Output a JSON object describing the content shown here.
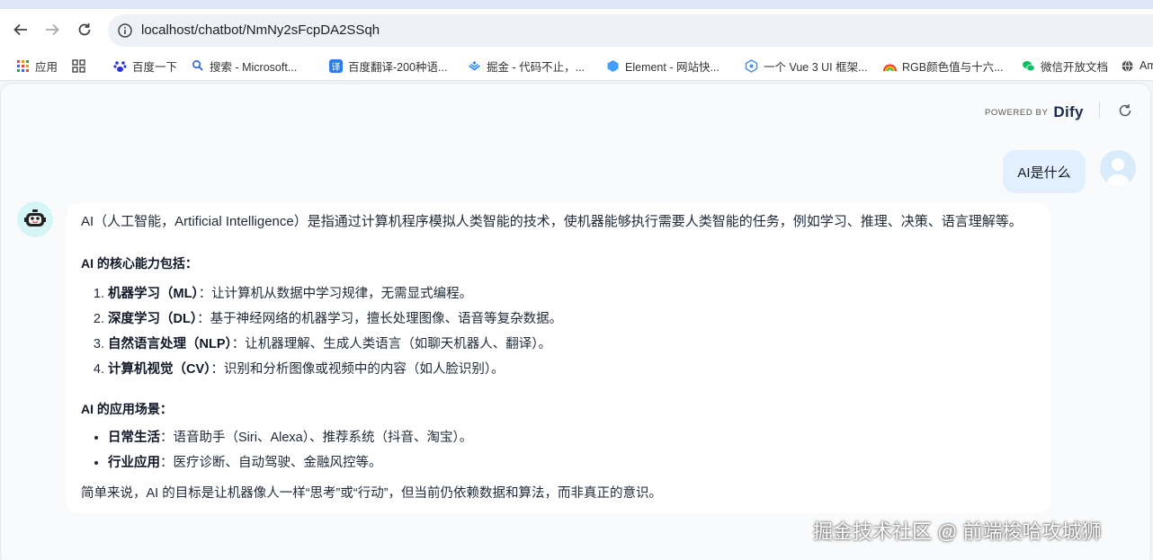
{
  "browser": {
    "url": "localhost/chatbot/NmNy2sFcpDA2SSqh",
    "bookmarks": [
      "应用",
      "百度一下",
      "搜索 - Microsoft...",
      "百度翻译-200种语...",
      "掘金 - 代码不止，...",
      "Element - 网站快...",
      "一个 Vue 3 UI 框架...",
      "RGB颜色值与十六...",
      "微信开放文档",
      "Am"
    ]
  },
  "header": {
    "powered_by": "POWERED BY",
    "brand": "Dify"
  },
  "chat": {
    "user_message": "AI是什么",
    "answer": {
      "intro": "AI（人工智能，Artificial Intelligence）是指通过计算机程序模拟人类智能的技术，使机器能够执行需要人类智能的任务，例如学习、推理、决策、语言理解等。",
      "core_heading": "AI 的核心能力包括：",
      "core_items": [
        {
          "term": "机器学习（ML）",
          "desc": "：让计算机从数据中学习规律，无需显式编程。"
        },
        {
          "term": "深度学习（DL）",
          "desc": "：基于神经网络的机器学习，擅长处理图像、语音等复杂数据。"
        },
        {
          "term": "自然语言处理（NLP）",
          "desc": "：让机器理解、生成人类语言（如聊天机器人、翻译）。"
        },
        {
          "term": "计算机视觉（CV）",
          "desc": "：识别和分析图像或视频中的内容（如人脸识别）。"
        }
      ],
      "scene_heading": "AI 的应用场景：",
      "scene_items": [
        {
          "term": "日常生活",
          "desc": "：语音助手（Siri、Alexa）、推荐系统（抖音、淘宝）。"
        },
        {
          "term": "行业应用",
          "desc": "：医疗诊断、自动驾驶、金融风控等。"
        }
      ],
      "outro": "简单来说，AI 的目标是让机器像人一样“思考”或“行动”，但当前仍依赖数据和算法，而非真正的意识。"
    }
  },
  "watermark": "掘金技术社区 @ 前端梭哈攻城狮"
}
